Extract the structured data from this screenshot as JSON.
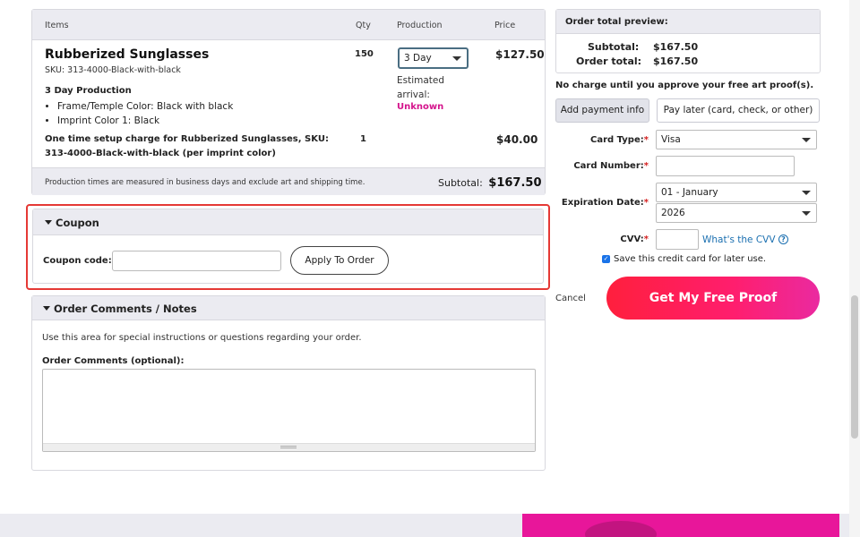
{
  "items_table": {
    "headers": {
      "items": "Items",
      "qty": "Qty",
      "production": "Production",
      "price": "Price"
    },
    "product": {
      "name": "Rubberized Sunglasses",
      "sku": "SKU: 313-4000-Black-with-black",
      "qty": "150",
      "production_selected": "3 Day",
      "estimated_label": "Estimated arrival:",
      "estimated_value": "Unknown",
      "price": "$127.50",
      "production_heading": "3 Day Production",
      "details": [
        "Frame/Temple Color: Black with black",
        "Imprint Color 1: Black"
      ]
    },
    "setup_charge": {
      "description": "One time setup charge for Rubberized Sunglasses, SKU: 313-4000-Black-with-black (per imprint color)",
      "qty": "1",
      "price": "$40.00"
    },
    "footer": {
      "note": "Production times are measured in business days and exclude art and shipping time.",
      "subtotal_label": "Subtotal:",
      "subtotal_value": "$167.50"
    }
  },
  "coupon": {
    "title": "Coupon",
    "code_label": "Coupon code:",
    "code_value": "",
    "apply_label": "Apply To Order"
  },
  "comments": {
    "title": "Order Comments / Notes",
    "help": "Use this area for special instructions or questions regarding your order.",
    "label": "Order Comments (optional):",
    "value": ""
  },
  "order_total": {
    "title": "Order total preview:",
    "subtotal_label": "Subtotal:",
    "subtotal_value": "$167.50",
    "total_label": "Order total:",
    "total_value": "$167.50"
  },
  "payment": {
    "no_charge_note": "No charge until you approve your free art proof(s).",
    "add_payment_label": "Add payment info",
    "pay_later_label": "Pay later (card, check, or other)",
    "card_type_label": "Card Type:",
    "card_type_value": "Visa",
    "card_number_label": "Card Number:",
    "card_number_value": "",
    "expiration_label": "Expiration Date:",
    "exp_month": "01 - January",
    "exp_year": "2026",
    "cvv_label": "CVV:",
    "cvv_value": "",
    "cvv_help": "What's the CVV",
    "save_card_label": "Save this credit card for later use.",
    "save_card_checked": true,
    "required_mark": "*",
    "cancel_label": "Cancel",
    "submit_label": "Get My Free Proof"
  },
  "colors": {
    "accent_pink": "#d4148c",
    "highlight_red": "#e53935",
    "button_gradient_start": "#ff1f3d",
    "button_gradient_end": "#ea2aa0",
    "link_blue": "#1a6fb0"
  },
  "icons": {
    "collapse": "caret-down-icon",
    "dropdown": "chevron-down-icon",
    "help": "question-circle-icon",
    "checkbox": "checkmark-icon"
  }
}
